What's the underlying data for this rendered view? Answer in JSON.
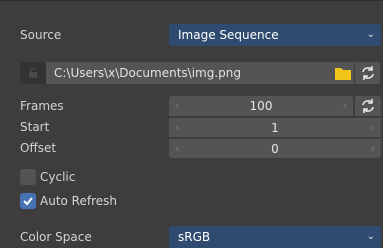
{
  "source": {
    "label": "Source",
    "value": "Image Sequence",
    "icon": "chevron-down-icon"
  },
  "file": {
    "path": "C:\\Users\\x\\Documents\\img.png",
    "folder_icon": "folder-icon",
    "reload_icon": "reload-icon",
    "lock_icon": "unlinked-lock-icon"
  },
  "frames": {
    "label": "Frames",
    "value": "100",
    "reload_icon": "reload-icon"
  },
  "start": {
    "label": "Start",
    "value": "1"
  },
  "offset": {
    "label": "Offset",
    "value": "0"
  },
  "cyclic": {
    "label": "Cyclic",
    "checked": false
  },
  "auto_refresh": {
    "label": "Auto Refresh",
    "checked": true
  },
  "color_space": {
    "label": "Color Space",
    "value": "sRGB",
    "icon": "chevron-down-icon"
  },
  "colors": {
    "background": "#3d3d3d",
    "field": "#545454",
    "dropdown": "#2f4b70",
    "checkbox_on": "#4772b3",
    "folder": "#f0c419"
  }
}
